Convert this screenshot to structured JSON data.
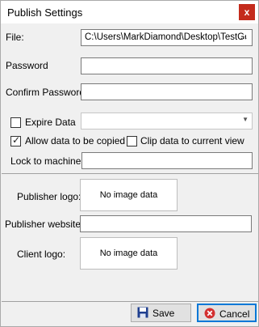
{
  "window": {
    "title": "Publish Settings",
    "close_label": "x"
  },
  "file": {
    "label": "File:",
    "value": "C:\\Users\\MarkDiamond\\Desktop\\TestGe",
    "browse_label": "..."
  },
  "password": {
    "label": "Password",
    "value": ""
  },
  "confirm_password": {
    "label": "Confirm Password",
    "value": ""
  },
  "expire": {
    "label": "Expire Data",
    "checked": false,
    "value": ""
  },
  "allow_copy": {
    "label": "Allow data to be copied",
    "checked": true
  },
  "clip": {
    "label": "Clip data to current view",
    "checked": false
  },
  "lock": {
    "label": "Lock to machine:",
    "value": ""
  },
  "publisher_logo": {
    "label": "Publisher logo:",
    "placeholder": "No image data"
  },
  "publisher_website": {
    "label": "Publisher website:",
    "value": ""
  },
  "client_logo": {
    "label": "Client logo:",
    "placeholder": "No image data"
  },
  "buttons": {
    "save_label": "Save",
    "cancel_label": "Cancel"
  },
  "colors": {
    "close_red": "#c42b1c",
    "accent_blue": "#0078d7",
    "save_icon": "#1f3f8f",
    "cancel_icon": "#d32f2f"
  }
}
